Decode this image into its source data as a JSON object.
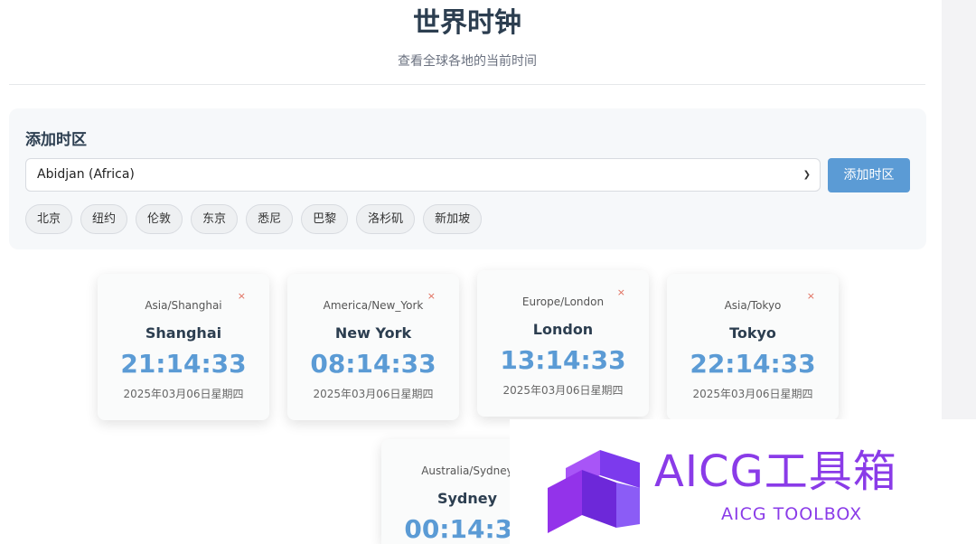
{
  "header": {
    "title": "世界时钟",
    "subtitle": "查看全球各地的当前时间"
  },
  "add_panel": {
    "title": "添加时区",
    "selected_timezone": "Abidjan (Africa)",
    "add_button_label": "添加时区",
    "quick_cities": [
      "北京",
      "纽约",
      "伦敦",
      "东京",
      "悉尼",
      "巴黎",
      "洛杉矶",
      "新加坡"
    ]
  },
  "clocks": [
    {
      "timezone": "Asia/Shanghai",
      "city": "Shanghai",
      "time": "21:14:33",
      "date": "2025年03月06日星期四"
    },
    {
      "timezone": "America/New_York",
      "city": "New York",
      "time": "08:14:33",
      "date": "2025年03月06日星期四"
    },
    {
      "timezone": "Europe/London",
      "city": "London",
      "time": "13:14:33",
      "date": "2025年03月06日星期四"
    },
    {
      "timezone": "Asia/Tokyo",
      "city": "Tokyo",
      "time": "22:14:33",
      "date": "2025年03月06日星期四"
    },
    {
      "timezone": "Australia/Sydney",
      "city": "Sydney",
      "time": "00:14:33",
      "date": ""
    }
  ],
  "close_glyph": "×",
  "watermark": {
    "main": "AICG工具箱",
    "sub": "AICG TOOLBOX",
    "color": "#8a3be8"
  },
  "accent_color": "#5b9bd5"
}
